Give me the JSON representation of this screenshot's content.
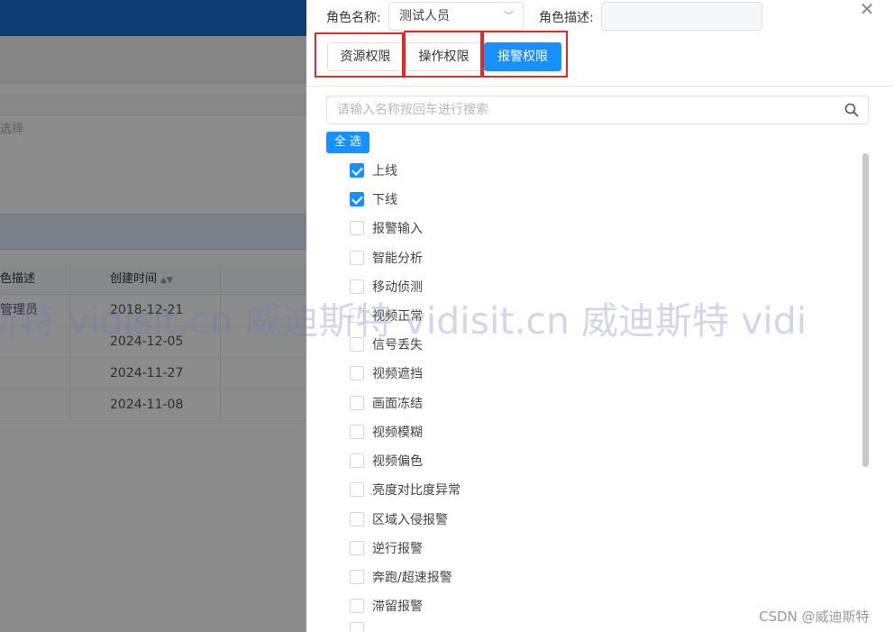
{
  "background": {
    "select_placeholder": "选择",
    "table": {
      "headers": [
        "色描述",
        "创建时间"
      ],
      "rows": [
        {
          "desc": "管理员",
          "created": "2018-12-21"
        },
        {
          "desc": "",
          "created": "2024-12-05"
        },
        {
          "desc": "",
          "created": "2024-11-27"
        },
        {
          "desc": "",
          "created": "2024-11-08"
        }
      ]
    }
  },
  "drawer": {
    "role_name_label": "角色名称:",
    "role_name_value": "测试人员",
    "role_desc_label": "角色描述:",
    "role_desc_value": "",
    "tabs": [
      {
        "label": "资源权限",
        "active": false
      },
      {
        "label": "操作权限",
        "active": false
      },
      {
        "label": "报警权限",
        "active": true
      }
    ],
    "search_placeholder": "请输入名称按回车进行搜索",
    "select_all_label": "全 选",
    "alarm_items": [
      {
        "label": "上线",
        "checked": true
      },
      {
        "label": "下线",
        "checked": true
      },
      {
        "label": "报警输入",
        "checked": false
      },
      {
        "label": "智能分析",
        "checked": false
      },
      {
        "label": "移动侦测",
        "checked": false
      },
      {
        "label": "视频正常",
        "checked": false
      },
      {
        "label": "信号丢失",
        "checked": false
      },
      {
        "label": "视频遮挡",
        "checked": false
      },
      {
        "label": "画面冻结",
        "checked": false
      },
      {
        "label": "视频模糊",
        "checked": false
      },
      {
        "label": "视频偏色",
        "checked": false
      },
      {
        "label": "亮度对比度异常",
        "checked": false
      },
      {
        "label": "区域入侵报警",
        "checked": false
      },
      {
        "label": "逆行报警",
        "checked": false
      },
      {
        "label": "奔跑/超速报警",
        "checked": false
      },
      {
        "label": "滞留报警",
        "checked": false
      },
      {
        "label": "",
        "checked": false
      }
    ]
  },
  "watermark": "斯特 vidisit.cn 威迪斯特 vidisit.cn 威迪斯特 vidi",
  "credit": "CSDN @威迪斯特",
  "colors": {
    "accent": "#1890ff",
    "highlight_box": "#e02a2a",
    "topbar": "#1a6fd1"
  }
}
